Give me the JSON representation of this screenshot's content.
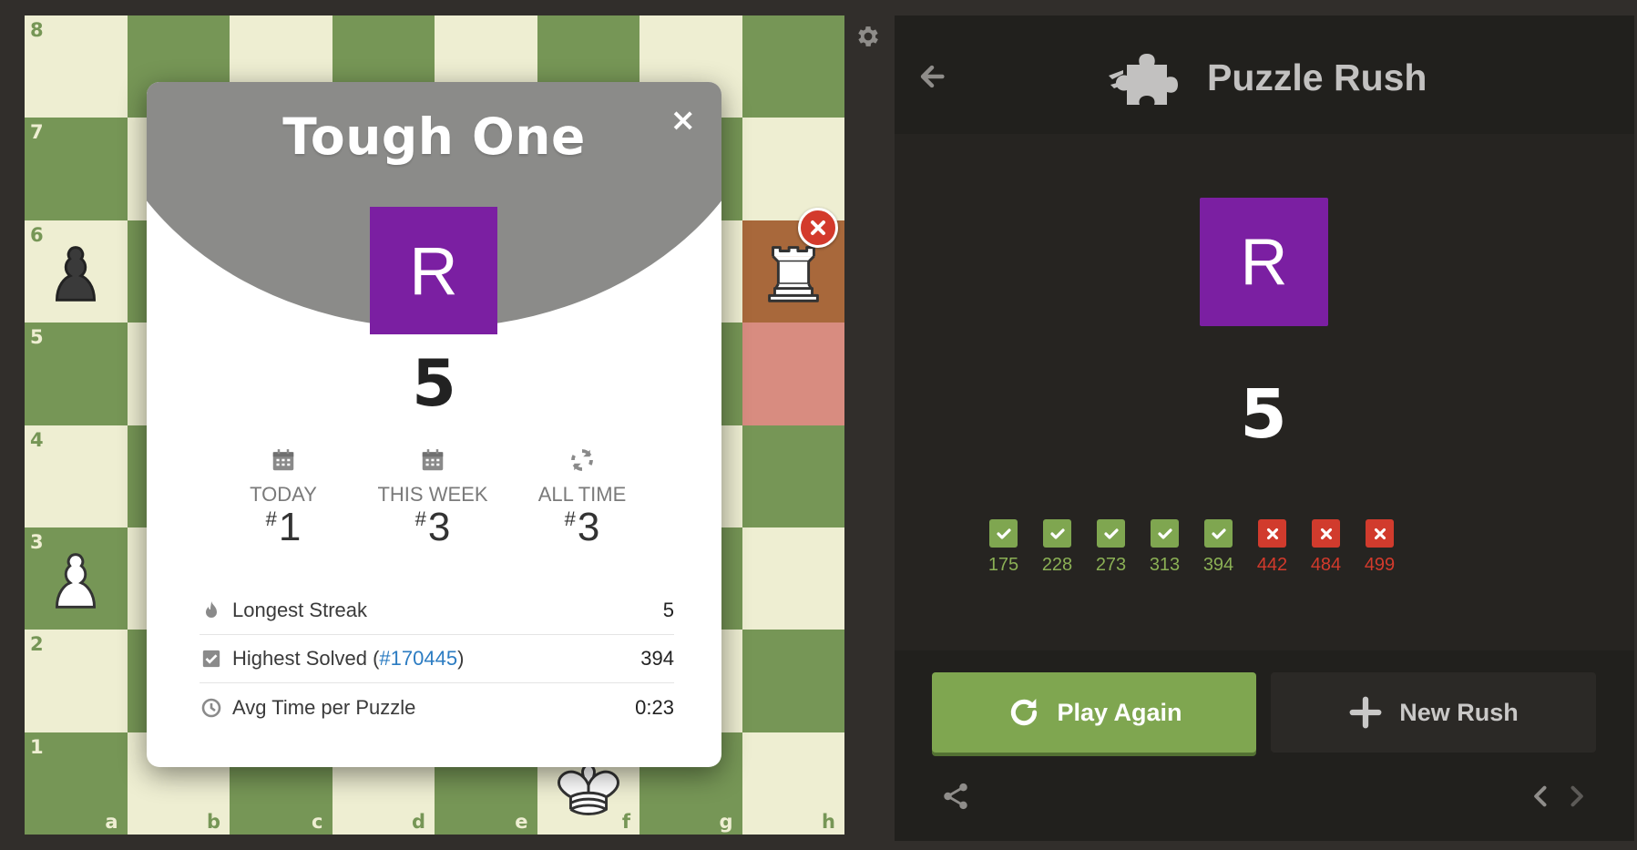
{
  "board": {
    "ranks": [
      "8",
      "7",
      "6",
      "5",
      "4",
      "3",
      "2",
      "1"
    ],
    "files": [
      "a",
      "b",
      "c",
      "d",
      "e",
      "f",
      "g",
      "h"
    ],
    "highlighted_squares": [
      "h6",
      "h5"
    ],
    "pieces": [
      {
        "square": "a6",
        "piece": "black-pawn"
      },
      {
        "square": "a3",
        "piece": "white-pawn"
      },
      {
        "square": "h6",
        "piece": "white-rook"
      },
      {
        "square": "f1",
        "piece": "white-king"
      }
    ],
    "wrong_move_icon": "x-circle-icon"
  },
  "modal": {
    "title": "Tough One",
    "close": "×",
    "avatar_letter": "R",
    "score": "5",
    "ranks": [
      {
        "icon": "calendar-icon",
        "label": "TODAY",
        "hash": "#",
        "value": "1"
      },
      {
        "icon": "calendar-icon",
        "label": "THIS WEEK",
        "hash": "#",
        "value": "3"
      },
      {
        "icon": "refresh-icon",
        "label": "ALL TIME",
        "hash": "#",
        "value": "3"
      }
    ],
    "stats": {
      "streak_label": "Longest Streak",
      "streak_value": "5",
      "highest_label": "Highest Solved (",
      "highest_link": "#170445",
      "highest_close": ")",
      "highest_value": "394",
      "avg_label": "Avg Time per Puzzle",
      "avg_value": "0:23"
    }
  },
  "panel": {
    "title": "Puzzle Rush",
    "avatar_letter": "R",
    "score": "5",
    "results": [
      {
        "status": "correct",
        "rating": "175"
      },
      {
        "status": "correct",
        "rating": "228"
      },
      {
        "status": "correct",
        "rating": "273"
      },
      {
        "status": "correct",
        "rating": "313"
      },
      {
        "status": "correct",
        "rating": "394"
      },
      {
        "status": "wrong",
        "rating": "442"
      },
      {
        "status": "wrong",
        "rating": "484"
      },
      {
        "status": "wrong",
        "rating": "499"
      }
    ],
    "play_again_label": "Play Again",
    "new_rush_label": "New Rush"
  },
  "colors": {
    "board_light": "#eeeed2",
    "board_dark": "#769656",
    "avatar": "#7b1fa2",
    "correct": "#7fa650",
    "wrong": "#d13b2d"
  }
}
